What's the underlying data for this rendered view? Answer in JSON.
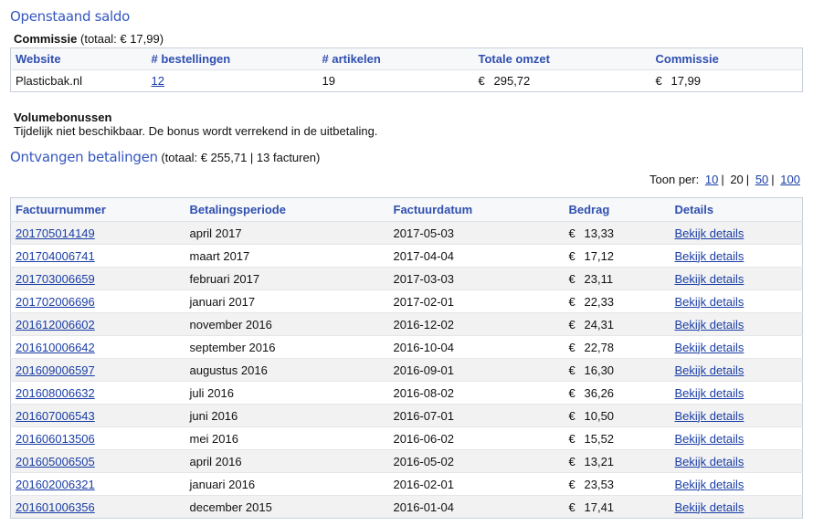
{
  "saldo_title": "Openstaand saldo",
  "commissie": {
    "label": "Commissie",
    "total": "(totaal: € 17,99)"
  },
  "commission_table": {
    "headers": [
      "Website",
      "# bestellingen",
      "# artikelen",
      "Totale omzet",
      "Commissie"
    ],
    "rows": [
      {
        "website": "Plasticbak.nl",
        "orders": "12",
        "articles": "19",
        "cur1": "€",
        "revenue": "295,72",
        "cur2": "€",
        "commission": "17,99"
      }
    ]
  },
  "volumebonussen": {
    "label": "Volumebonussen",
    "text": "Tijdelijk niet beschikbaar. De bonus wordt verrekend in de uitbetaling."
  },
  "ontvangen": {
    "title": "Ontvangen betalingen",
    "summary": "(totaal: € 255,71 | 13 facturen)"
  },
  "pagination": {
    "label": "Toon per:",
    "options": [
      "10",
      "20",
      "50",
      "100"
    ],
    "selected": "20",
    "sep": "|"
  },
  "payments_table": {
    "headers": [
      "Factuurnummer",
      "Betalingsperiode",
      "Factuurdatum",
      "Bedrag",
      "Details"
    ],
    "currency": "€",
    "rows": [
      {
        "invoice": "201705014149",
        "period": "april 2017",
        "date": "2017-05-03",
        "amount": "13,33",
        "details": "Bekijk details"
      },
      {
        "invoice": "201704006741",
        "period": "maart 2017",
        "date": "2017-04-04",
        "amount": "17,12",
        "details": "Bekijk details"
      },
      {
        "invoice": "201703006659",
        "period": "februari 2017",
        "date": "2017-03-03",
        "amount": "23,11",
        "details": "Bekijk details"
      },
      {
        "invoice": "201702006696",
        "period": "januari 2017",
        "date": "2017-02-01",
        "amount": "22,33",
        "details": "Bekijk details"
      },
      {
        "invoice": "201612006602",
        "period": "november 2016",
        "date": "2016-12-02",
        "amount": "24,31",
        "details": "Bekijk details"
      },
      {
        "invoice": "201610006642",
        "period": "september 2016",
        "date": "2016-10-04",
        "amount": "22,78",
        "details": "Bekijk details"
      },
      {
        "invoice": "201609006597",
        "period": "augustus 2016",
        "date": "2016-09-01",
        "amount": "16,30",
        "details": "Bekijk details"
      },
      {
        "invoice": "201608006632",
        "period": "juli 2016",
        "date": "2016-08-02",
        "amount": "36,26",
        "details": "Bekijk details"
      },
      {
        "invoice": "201607006543",
        "period": "juni 2016",
        "date": "2016-07-01",
        "amount": "10,50",
        "details": "Bekijk details"
      },
      {
        "invoice": "201606013506",
        "period": "mei 2016",
        "date": "2016-06-02",
        "amount": "15,52",
        "details": "Bekijk details"
      },
      {
        "invoice": "201605006505",
        "period": "april 2016",
        "date": "2016-05-02",
        "amount": "13,21",
        "details": "Bekijk details"
      },
      {
        "invoice": "201602006321",
        "period": "januari 2016",
        "date": "2016-02-01",
        "amount": "23,53",
        "details": "Bekijk details"
      },
      {
        "invoice": "201601006356",
        "period": "december 2015",
        "date": "2016-01-04",
        "amount": "17,41",
        "details": "Bekijk details"
      }
    ]
  }
}
